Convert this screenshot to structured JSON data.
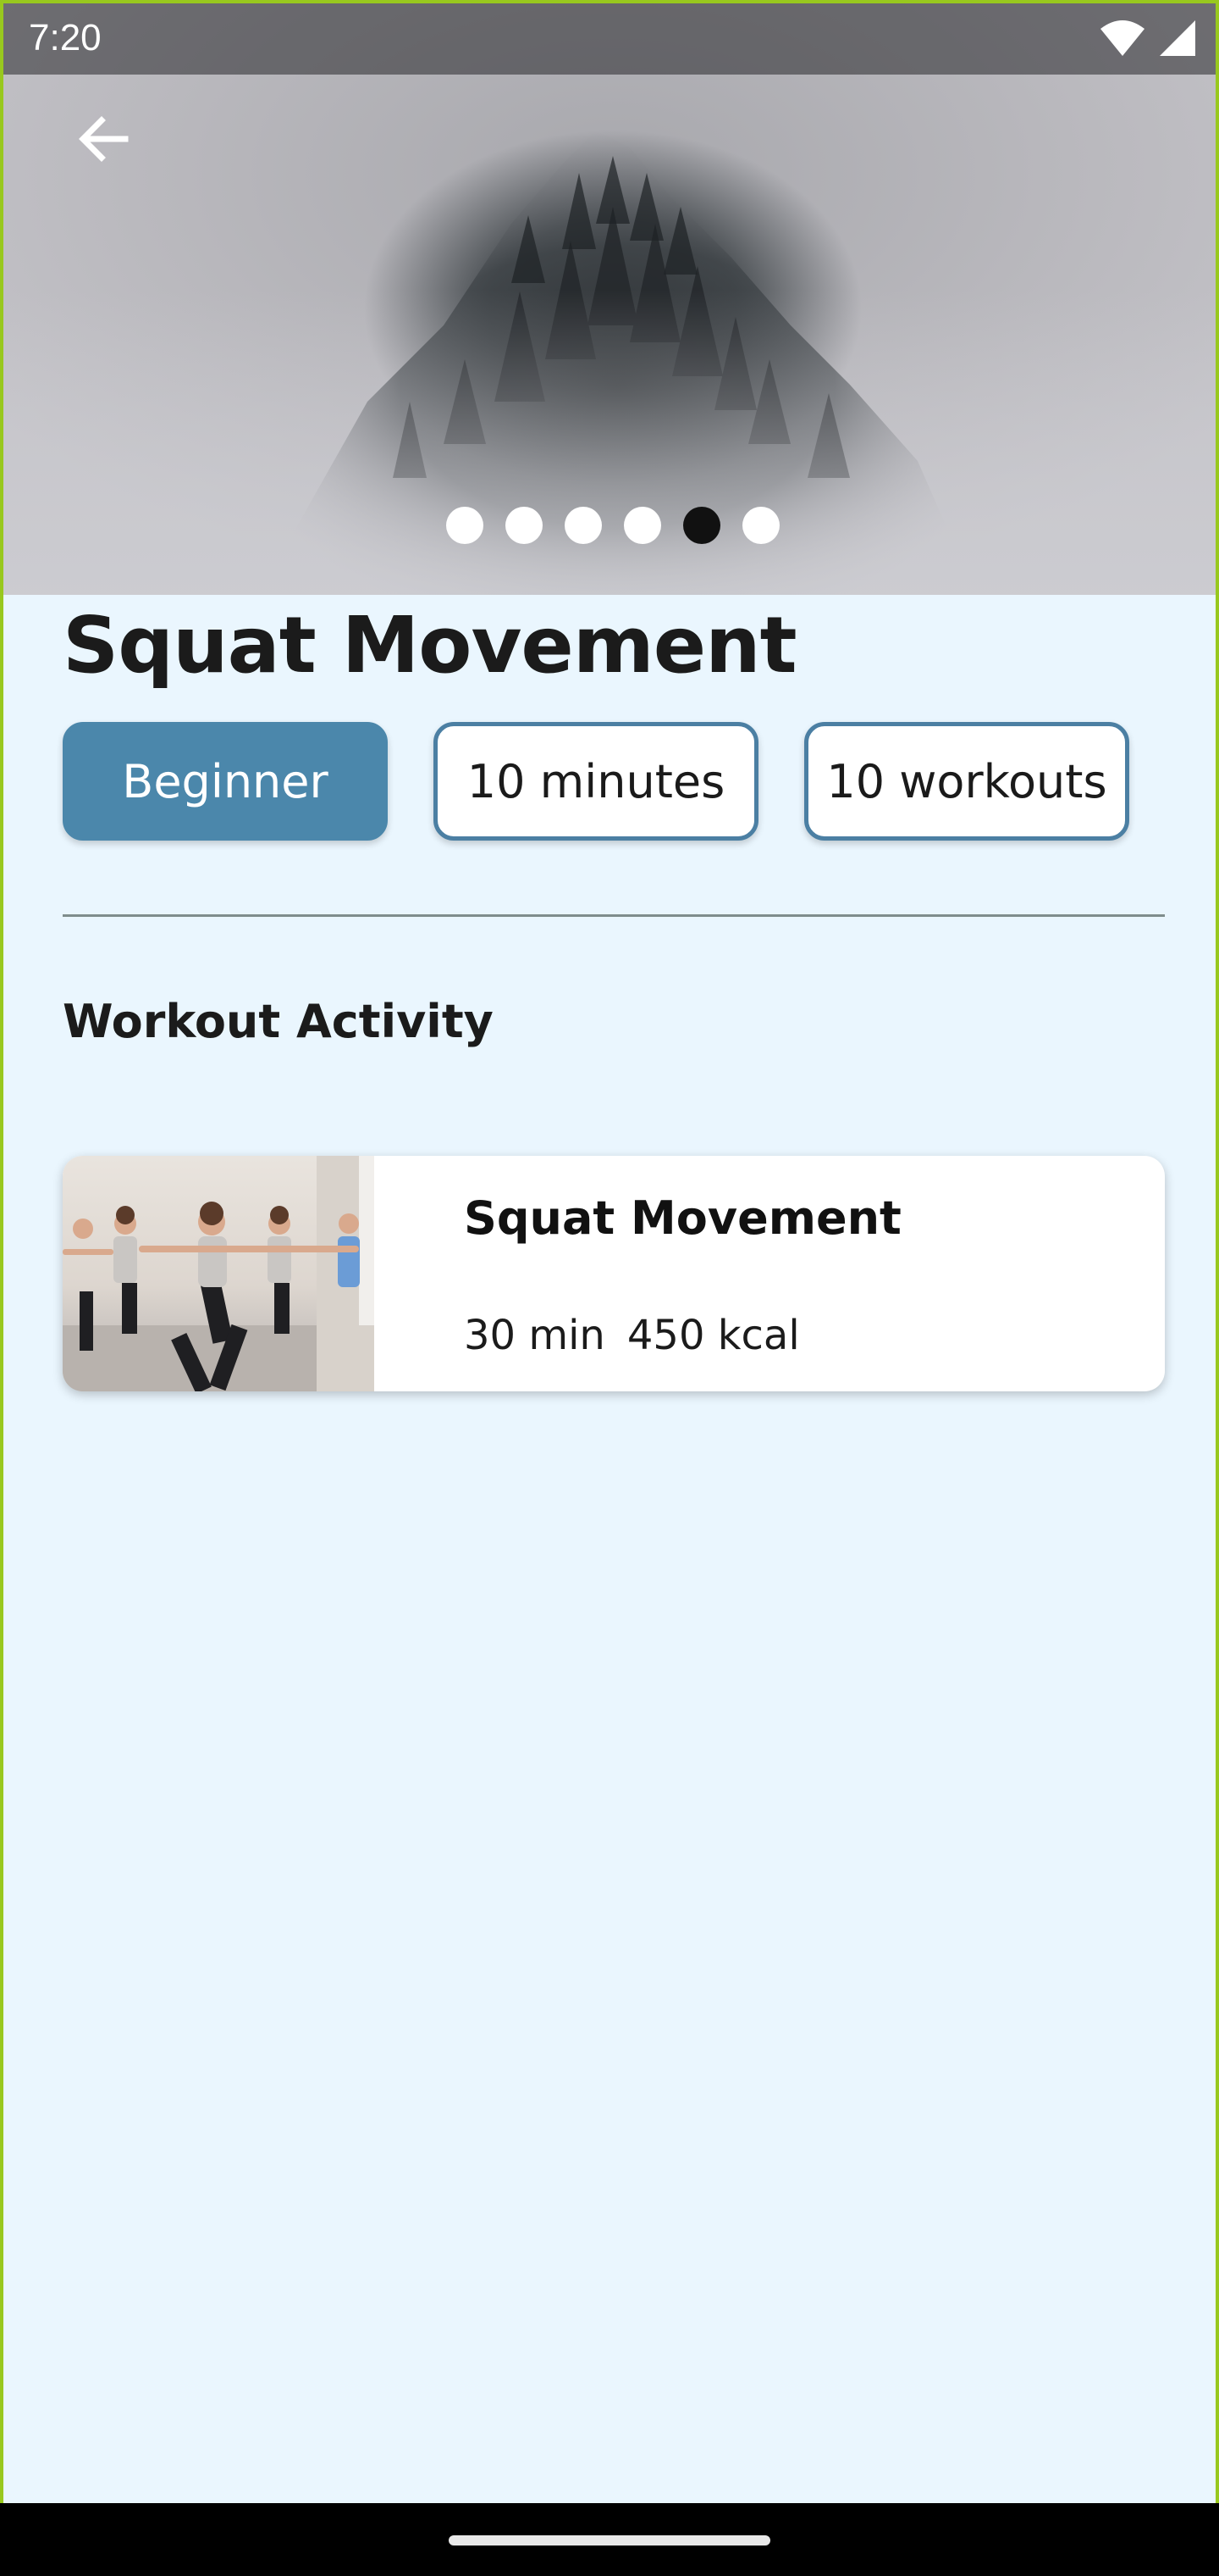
{
  "status_bar": {
    "time": "7:20",
    "icons": [
      "wifi-icon",
      "signal-icon"
    ]
  },
  "hero": {
    "back_icon": "arrow-left-icon",
    "carousel": {
      "page_count": 6,
      "active_index": 4
    }
  },
  "workout": {
    "title": "Squat Movement",
    "chips": [
      {
        "label": "Beginner",
        "style": "filled"
      },
      {
        "label": "10 minutes",
        "style": "outlined"
      },
      {
        "label": "10 workouts",
        "style": "outlined"
      }
    ]
  },
  "activity": {
    "section_title": "Workout Activity",
    "items": [
      {
        "title": "Squat Movement",
        "duration": "30 min",
        "calories": "450 kcal"
      }
    ]
  },
  "colors": {
    "background": "#eaf6fe",
    "accent": "#4b87ab",
    "chip_border": "#4b7fa3",
    "frame": "#98c81e"
  }
}
